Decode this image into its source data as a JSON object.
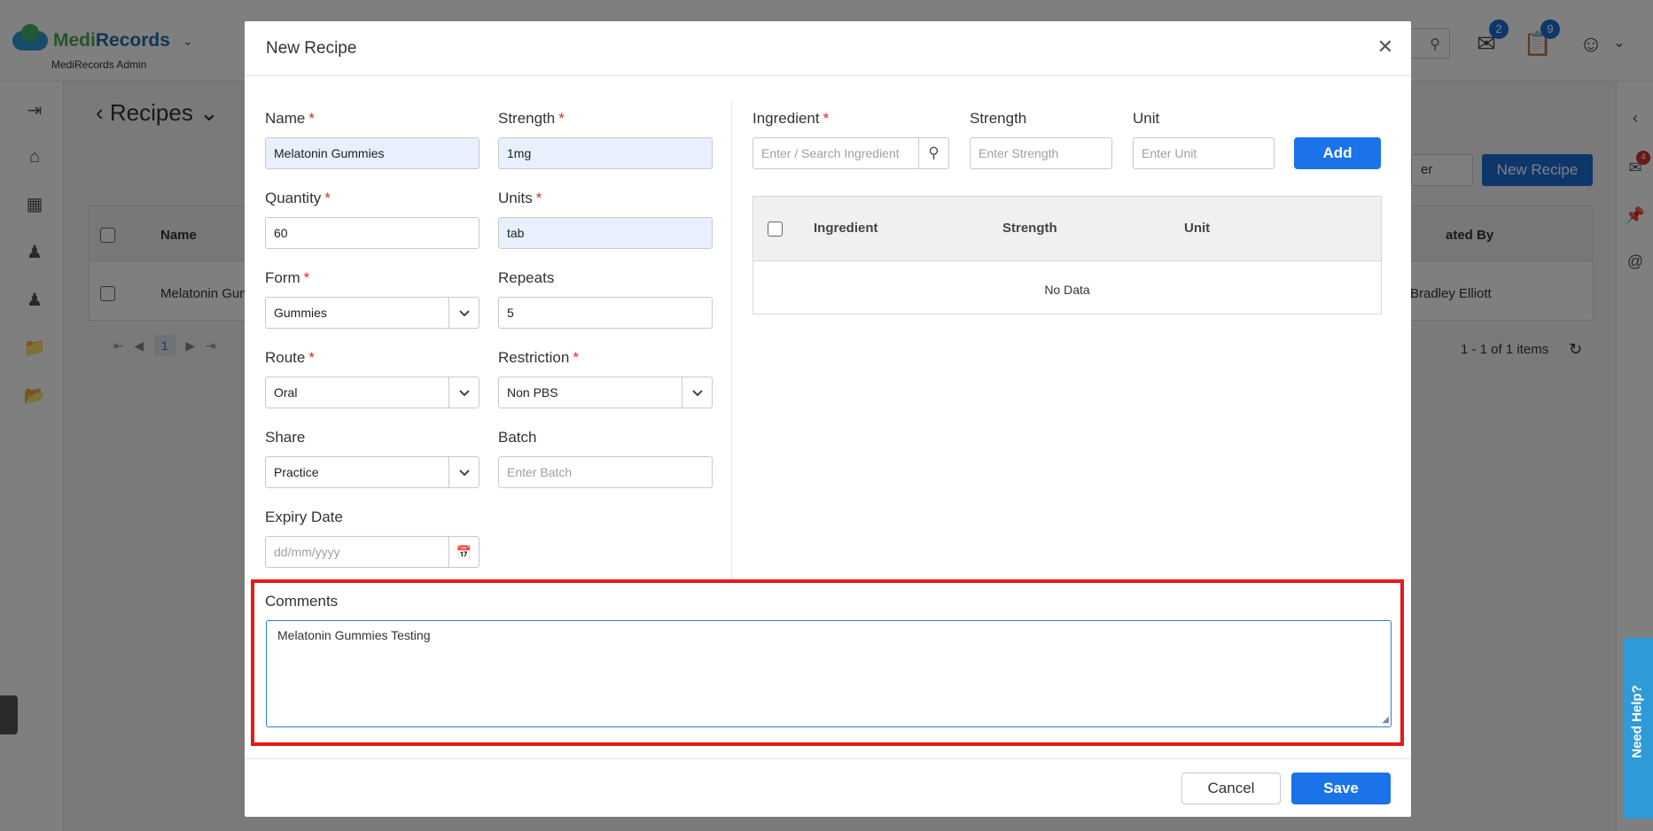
{
  "app": {
    "brand_a": "Medi",
    "brand_b": "Records",
    "subtitle": "MediRecords Admin",
    "mail_badge": "2",
    "tasks_badge": "9",
    "chat_badge": "4"
  },
  "background": {
    "page_title": "Recipes",
    "new_recipe_button": "New Recipe",
    "filter_label": "er",
    "table_header_name": "Name",
    "table_header_created": "ated By",
    "row_name": "Melatonin Gum",
    "row_created_by": "Bradley Elliott",
    "page_number": "1",
    "pager_summary": "1 - 1 of 1 items",
    "need_help": "Need Help?"
  },
  "modal": {
    "title": "New Recipe",
    "fields": {
      "name": {
        "label": "Name",
        "value": "Melatonin Gummies"
      },
      "strength": {
        "label": "Strength",
        "value": "1mg"
      },
      "quantity": {
        "label": "Quantity",
        "value": "60"
      },
      "units": {
        "label": "Units",
        "value": "tab"
      },
      "form": {
        "label": "Form",
        "value": "Gummies"
      },
      "repeats": {
        "label": "Repeats",
        "value": "5"
      },
      "route": {
        "label": "Route",
        "value": "Oral"
      },
      "restriction": {
        "label": "Restriction",
        "value": "Non PBS"
      },
      "share": {
        "label": "Share",
        "value": "Practice"
      },
      "batch": {
        "label": "Batch",
        "placeholder": "Enter Batch"
      },
      "expiry": {
        "label": "Expiry Date",
        "placeholder": "dd/mm/yyyy"
      }
    },
    "ingredient_form": {
      "ingredient_label": "Ingredient",
      "ingredient_placeholder": "Enter / Search Ingredient",
      "strength_label": "Strength",
      "strength_placeholder": "Enter Strength",
      "unit_label": "Unit",
      "unit_placeholder": "Enter Unit",
      "add_button": "Add"
    },
    "ingredient_table": {
      "columns": [
        "Ingredient",
        "Strength",
        "Unit"
      ],
      "empty_text": "No Data"
    },
    "comments": {
      "label": "Comments",
      "value": "Melatonin Gummies Testing"
    },
    "cancel_button": "Cancel",
    "save_button": "Save",
    "required_mark": "*"
  },
  "colors": {
    "primary": "#1a73e8",
    "highlight": "#e31b1b"
  }
}
